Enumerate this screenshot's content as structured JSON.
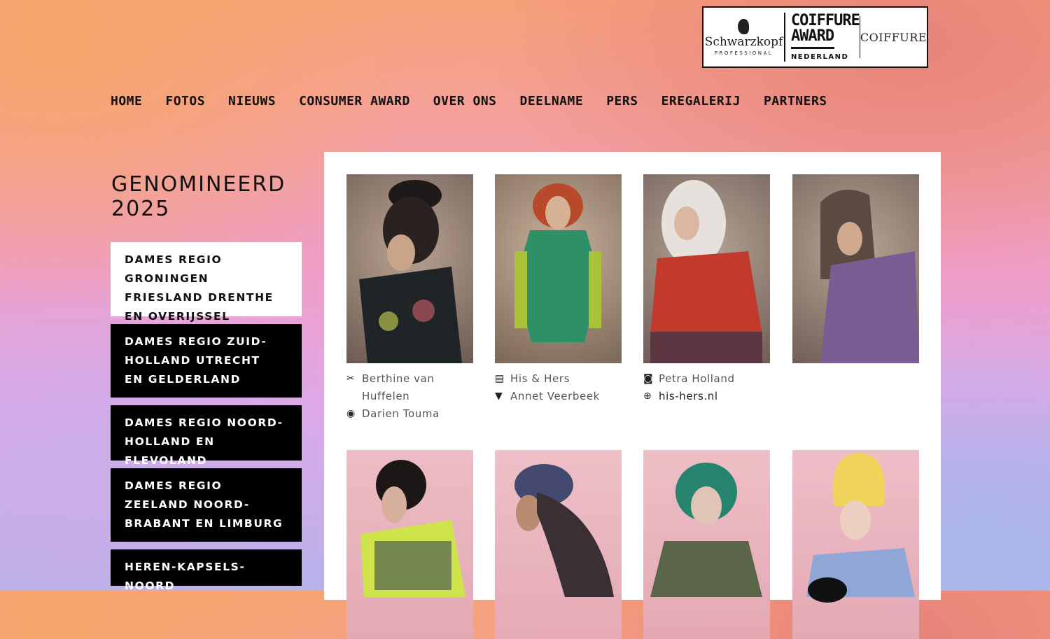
{
  "logo": {
    "brand": "Schwarzkopf",
    "brand_sub": "PROFESSIONAL",
    "award_line1": "COIFFURE",
    "award_line2": "AWARD",
    "award_line3": "NEDERLAND",
    "partner": "COIFFURE"
  },
  "nav": [
    "HOME",
    "FOTOS",
    "NIEUWS",
    "CONSUMER AWARD",
    "OVER ONS",
    "DEELNAME",
    "PERS",
    "EREGALERIJ",
    "PARTNERS"
  ],
  "sidebar": {
    "title_line1": "GENOMINEERD",
    "title_line2": "2025",
    "items": [
      {
        "label": "DAMES REGIO GRONINGEN FRIESLAND DRENTHE EN OVERIJSSEL",
        "active": true
      },
      {
        "label": "DAMES REGIO ZUID-HOLLAND UTRECHT EN GELDERLAND",
        "active": false
      },
      {
        "label": "DAMES REGIO NOORD-HOLLAND EN FLEVOLAND",
        "active": false
      },
      {
        "label": "DAMES REGIO ZEELAND NOORD-BRABANT EN LIMBURG",
        "active": false
      },
      {
        "label": "HEREN-KAPSELS-NOORD",
        "active": false
      }
    ]
  },
  "credits": {
    "col1": [
      {
        "icon": "scissors-icon",
        "text": "Berthine van Huffelen"
      },
      {
        "icon": "eye-icon",
        "text": "Darien Touma"
      }
    ],
    "col2": [
      {
        "icon": "store-icon",
        "text": "His & Hers"
      },
      {
        "icon": "tshirt-icon",
        "text": "Annet Veerbeek"
      }
    ],
    "col3": [
      {
        "icon": "camera-icon",
        "text": "Petra Holland"
      },
      {
        "icon": "globe-icon",
        "text": "his-hers.nl"
      }
    ]
  },
  "colors": {
    "active_bg": "#ffffff",
    "inactive_bg": "#000000",
    "row1_photo_bg": "#9a8577",
    "row2_photo_bg": "#e7b2bb"
  }
}
